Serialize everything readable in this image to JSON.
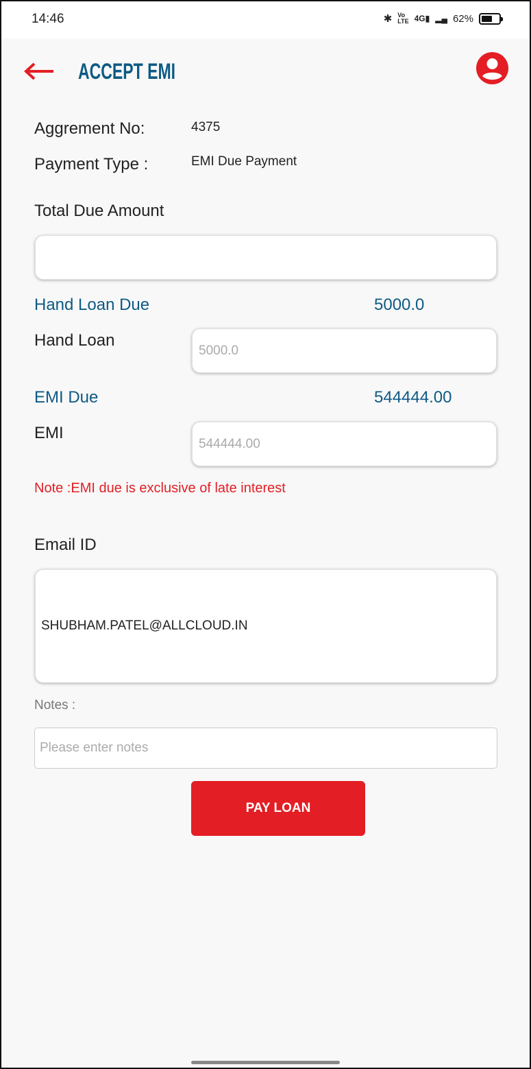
{
  "status_bar": {
    "time": "14:46",
    "battery": "62%",
    "battery_level": 0.62,
    "icons": [
      "bluetooth-icon",
      "volte-icon",
      "signal-4g-icon",
      "signal-icon",
      "battery-icon"
    ]
  },
  "header": {
    "title": "ACCEPT EMI",
    "back_icon": "arrow-left-icon",
    "profile_icon": "account-circle-icon"
  },
  "colors": {
    "accent": "#e31e24",
    "primary": "#0e5a84"
  },
  "form": {
    "agreement_label": "Aggrement No:",
    "agreement_value": "4375",
    "payment_type_label": "Payment Type :",
    "payment_type_value": "EMI Due Payment",
    "total_due_label": "Total Due Amount",
    "total_due_value": "",
    "hand_loan_due_label": "Hand Loan Due",
    "hand_loan_due_value": "5000.0",
    "hand_loan_label": "Hand Loan",
    "hand_loan_placeholder": "5000.0",
    "emi_due_label": "EMI Due",
    "emi_due_value": "544444.00",
    "emi_label": "EMI",
    "emi_placeholder": "544444.00",
    "note": "Note :EMI due is exclusive of late interest",
    "email_label": "Email ID",
    "email_value": "SHUBHAM.PATEL@ALLCLOUD.IN",
    "notes_label": "Notes :",
    "notes_placeholder": "Please enter notes",
    "pay_button": "PAY LOAN"
  }
}
